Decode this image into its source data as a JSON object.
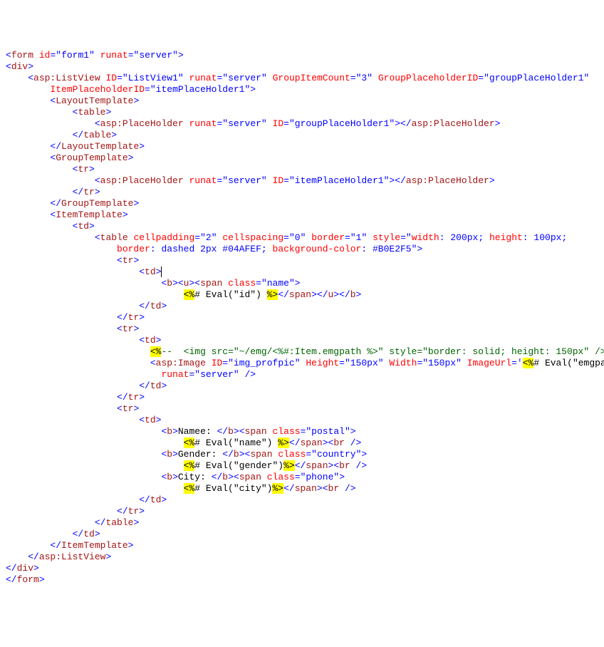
{
  "line01_form_tag": "form",
  "line01_id_attr": "id",
  "line01_id_val": "form1",
  "line01_runat_attr": "runat",
  "line01_runat_val": "server",
  "line02_div": "div",
  "line03_tag": "asp:ListView",
  "line03_ID_attr": "ID",
  "line03_ID_val": "ListView1",
  "line03_runat_attr": "runat",
  "line03_runat_val": "server",
  "line03_gic_attr": "GroupItemCount",
  "line03_gic_val": "3",
  "line03_gph_attr": "GroupPlaceholderID",
  "line03_gph_val": "groupPlaceHolder1",
  "line04_iph_attr": "ItemPlaceholderID",
  "line04_iph_val": "itemPlaceHolder1",
  "line05_layouttemplate": "LayoutTemplate",
  "line06_table": "table",
  "line07_tag": "asp:PlaceHolder",
  "line07_runat_attr": "runat",
  "line07_runat_val": "server",
  "line07_ID_attr": "ID",
  "line07_ID_val": "groupPlaceHolder1",
  "line09_grouptemplate": "GroupTemplate",
  "line10_tr": "tr",
  "line11_tag": "asp:PlaceHolder",
  "line11_runat_attr": "runat",
  "line11_runat_val": "server",
  "line11_ID_attr": "ID",
  "line11_ID_val": "itemPlaceHolder1",
  "line13_itemtemplate": "ItemTemplate",
  "line14_td": "td",
  "line15_tag": "table",
  "line15_cellpadding_attr": "cellpadding",
  "line15_cellpadding_val": "2",
  "line15_cellspacing_attr": "cellspacing",
  "line15_cellspacing_val": "0",
  "line15_border_attr": "border",
  "line15_border_val": "1",
  "line15_style_attr": "style",
  "line15_style_width_prop": "width",
  "line15_style_width_val": "200px",
  "line15_style_height_prop": "height",
  "line15_style_height_val": "100px",
  "line16_border_prop": "border",
  "line16_border_val": "dashed 2px #04AFEF",
  "line16_bg_prop": "background-color",
  "line16_bg_val": "#B0E2F5",
  "line17_b": "b",
  "line17_u": "u",
  "line17_span": "span",
  "line17_class_attr": "class",
  "line17_class_val": "name",
  "line18_asp_open": "<%",
  "line18_eval": "# Eval(\"id\") ",
  "line18_asp_close": "%>",
  "line20_asp_open": "<%",
  "line20_comment_start": "--",
  "line20_comment_body": "  <img src=\"~/emg/<%#:Item.emgpath %>\" style=\"border: solid; height: 150px\" />--",
  "line20_asp_close": "%>",
  "line21_tag": "asp:Image",
  "line21_ID_attr": "ID",
  "line21_ID_val": "img_profpic",
  "line21_Height_attr": "Height",
  "line21_Height_val": "150px",
  "line21_Width_attr": "Width",
  "line21_Width_val": "150px",
  "line21_ImageUrl_attr": "ImageUrl",
  "line21_ImageUrl_open": "'",
  "line21_ImageUrl_asp_open": "<%",
  "line21_ImageUrl_eval": "# Eval(\"emgpath\") ",
  "line21_ImageUrl_asp_close": "%>",
  "line21_ImageUrl_close": "'",
  "line22_runat_attr": "runat",
  "line22_runat_val": "server",
  "line25_namee_label": "Namee: ",
  "line25_class_val": "postal",
  "line26_eval": "# Eval(\"name\") ",
  "line27_gender_label": "Gender: ",
  "line27_class_val": "country",
  "line28_eval": "# Eval(\"gender\")",
  "line29_city_label": "City: ",
  "line29_class_val": "phone",
  "line30_eval": "# Eval(\"city\")",
  "line_br": "br",
  "line_span": "span",
  "line_class_attr": "class"
}
